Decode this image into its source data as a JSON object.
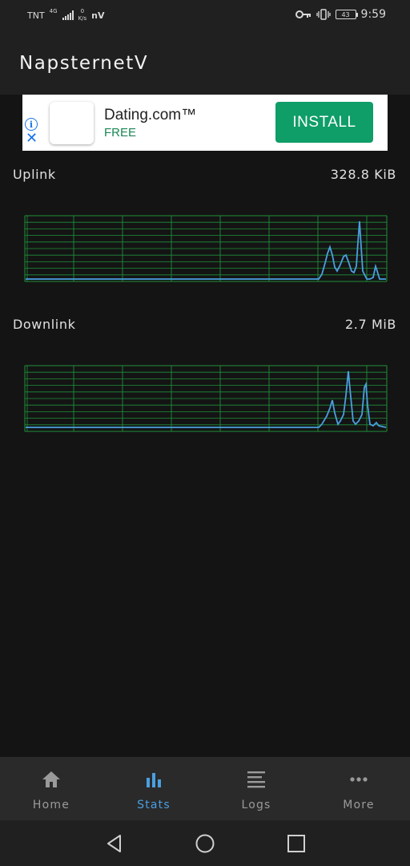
{
  "status_bar": {
    "carrier": "TNT",
    "network": "4G",
    "speed_value": "0",
    "speed_unit": "K/s",
    "app_indicator": "nV",
    "battery": "43",
    "time": "9:59"
  },
  "app": {
    "title": "NapsternetV"
  },
  "ad": {
    "title": "Dating.com™",
    "subtitle": "FREE",
    "install_label": "INSTALL"
  },
  "stats": {
    "uplink": {
      "label": "Uplink",
      "value": "328.8 KiB"
    },
    "downlink": {
      "label": "Downlink",
      "value": "2.7 MiB"
    }
  },
  "graph_colors": {
    "grid": "#1f8f3a",
    "line": "#4a9fe0"
  },
  "bottom_nav": {
    "items": [
      {
        "label": "Home",
        "icon": "home-icon"
      },
      {
        "label": "Stats",
        "icon": "bar-chart-icon",
        "active": true
      },
      {
        "label": "Logs",
        "icon": "list-lines-icon"
      },
      {
        "label": "More",
        "icon": "more-dots-icon"
      }
    ]
  },
  "system_nav": {
    "icons": [
      "back-icon",
      "home-circle-icon",
      "recents-icon"
    ]
  }
}
